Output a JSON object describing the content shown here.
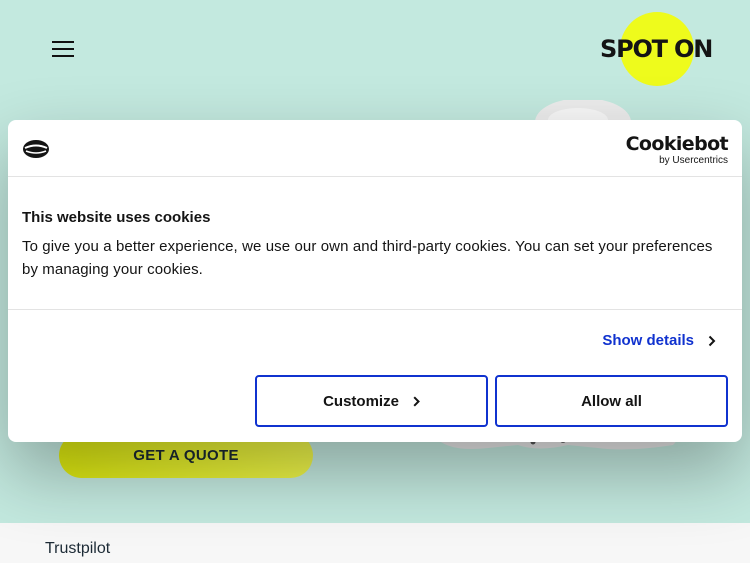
{
  "header": {
    "logo_text": "SPOT ON",
    "menu_icon": "hamburger-icon"
  },
  "hero": {
    "cta_label": "GET A QUOTE"
  },
  "trust": {
    "label": "Trustpilot"
  },
  "cookie_dialog": {
    "brand_name": "Cookiebot",
    "brand_sub": "by Usercentrics",
    "title": "This website uses cookies",
    "body": "To give you a better experience, we use our own and third-party cookies. You can set your preferences by managing your cookies.",
    "show_details_label": "Show details",
    "customize_label": "Customize",
    "allow_all_label": "Allow all"
  },
  "colors": {
    "page_bg": "#c3e9df",
    "brand_yellow": "#eefb1c",
    "link_blue": "#1032cf",
    "text_dark": "#141414"
  }
}
